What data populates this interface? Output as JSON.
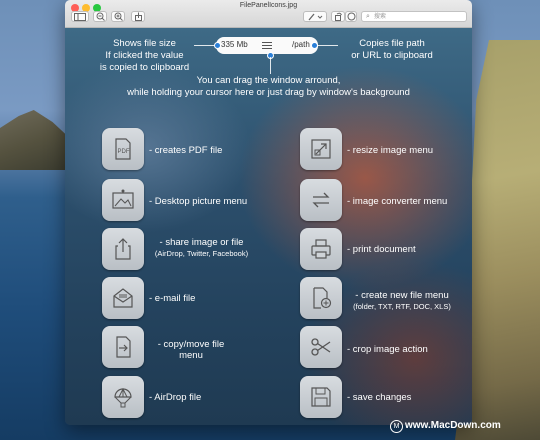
{
  "window": {
    "title": "FilePanelIcons.jpg"
  },
  "search": {
    "placeholder": "搜索"
  },
  "pill": {
    "size": "335 Mb",
    "path": "/path"
  },
  "annotations": {
    "left_lines": [
      "Shows file size",
      "If clicked the value",
      "is copied to clipboard"
    ],
    "right_lines": [
      "Copies file path",
      "or URL to clipboard"
    ],
    "drag_lines": [
      "You can drag the window arround,",
      "while holding your cursor here or just drag by window's background"
    ]
  },
  "actions_left": [
    {
      "label": "- creates PDF file",
      "icon": "pdf-icon",
      "icon_text": "PDF"
    },
    {
      "label": "- Desktop picture menu",
      "icon": "desktop-picture-icon"
    },
    {
      "label": "- share image or file",
      "sub": "(AirDrop, Twitter, Facebook)",
      "icon": "share-icon"
    },
    {
      "label": "- e-mail file",
      "icon": "email-icon"
    },
    {
      "label_lines": [
        "- copy/move file",
        "menu"
      ],
      "icon": "copy-move-icon"
    },
    {
      "label": "- AirDrop file",
      "icon": "airdrop-icon"
    }
  ],
  "actions_right": [
    {
      "label": "- resize image menu",
      "icon": "resize-icon"
    },
    {
      "label": "- image converter menu",
      "icon": "convert-icon"
    },
    {
      "label": "- print document",
      "icon": "print-icon"
    },
    {
      "label": "- create new file menu",
      "sub": "(folder, TXT, RTF, DOC, XLS)",
      "icon": "new-file-icon"
    },
    {
      "label": "- crop image action",
      "icon": "crop-icon"
    },
    {
      "label": "- save changes",
      "icon": "save-icon"
    }
  ],
  "watermark": "www.MacDown.com",
  "watermark_icon_text": "M",
  "colors": {
    "accent": "#2a7fd8",
    "tile": "#c9cdd2"
  }
}
